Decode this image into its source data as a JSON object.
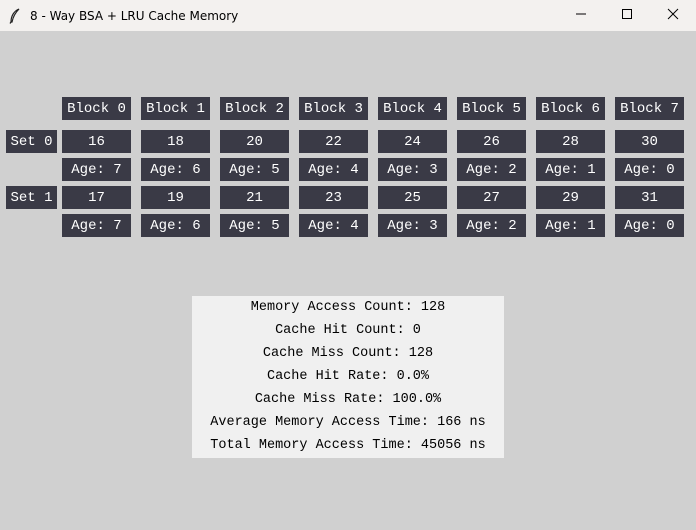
{
  "window": {
    "title": "8 - Way BSA + LRU Cache Memory"
  },
  "blocks": [
    "Block 0",
    "Block 1",
    "Block 2",
    "Block 3",
    "Block 4",
    "Block 5",
    "Block 6",
    "Block 7"
  ],
  "sets": [
    {
      "label": "Set 0",
      "values": [
        "16",
        "18",
        "20",
        "22",
        "24",
        "26",
        "28",
        "30"
      ],
      "ages": [
        "Age: 7",
        "Age: 6",
        "Age: 5",
        "Age: 4",
        "Age: 3",
        "Age: 2",
        "Age: 1",
        "Age: 0"
      ]
    },
    {
      "label": "Set 1",
      "values": [
        "17",
        "19",
        "21",
        "23",
        "25",
        "27",
        "29",
        "31"
      ],
      "ages": [
        "Age: 7",
        "Age: 6",
        "Age: 5",
        "Age: 4",
        "Age: 3",
        "Age: 2",
        "Age: 1",
        "Age: 0"
      ]
    }
  ],
  "stats": [
    "Memory Access Count: 128",
    "Cache Hit Count: 0",
    "Cache Miss Count: 128",
    "Cache Hit Rate: 0.0%",
    "Cache Miss Rate: 100.0%",
    "Average Memory Access Time: 166 ns",
    "Total Memory Access Time: 45056 ns"
  ],
  "colors": {
    "cell_bg": "#3a3a46",
    "cell_text": "#ffffff",
    "window_bg": "#d0d0d0",
    "stats_bg": "#f0f0f0"
  }
}
